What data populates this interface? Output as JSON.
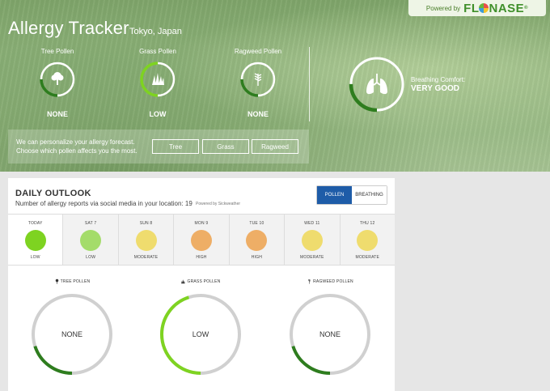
{
  "header": {
    "title": "Allergy Tracker",
    "location": "Tokyo, Japan",
    "sponsor_text": "Powered by",
    "brand_left": "FL",
    "brand_right": "NASE",
    "brand_mark": "®"
  },
  "pollen": [
    {
      "label": "Tree Pollen",
      "level": "NONE",
      "icon": "tree-icon",
      "fill": 0.25
    },
    {
      "label": "Grass Pollen",
      "level": "LOW",
      "icon": "grass-icon",
      "fill": 0.5
    },
    {
      "label": "Ragweed Pollen",
      "level": "NONE",
      "icon": "ragweed-icon",
      "fill": 0.25
    }
  ],
  "breathing": {
    "label": "Breathing Comfort:",
    "value": "VERY GOOD",
    "icon": "lungs-icon",
    "fill": 0.25
  },
  "personalize": {
    "line1": "We can personalize your allergy forecast.",
    "line2": "Choose which pollen affects you the most.",
    "buttons": [
      "Tree",
      "Grass",
      "Ragweed"
    ]
  },
  "outlook": {
    "title": "DAILY OUTLOOK",
    "subtitle": "Number of allergy reports via social media in your location: 19",
    "powered": "Powered by Sickweather",
    "toggle": {
      "pollen": "POLLEN",
      "breathing": "BREATHING"
    },
    "days": [
      {
        "name": "TODAY",
        "level": "LOW",
        "color": "#7ed321"
      },
      {
        "name": "SAT 7",
        "level": "LOW",
        "color": "#a4dc6a"
      },
      {
        "name": "SUN 8",
        "level": "MODERATE",
        "color": "#efdc6e"
      },
      {
        "name": "MON 9",
        "level": "HIGH",
        "color": "#eeae66"
      },
      {
        "name": "TUE 10",
        "level": "HIGH",
        "color": "#eeae66"
      },
      {
        "name": "WED 11",
        "level": "MODERATE",
        "color": "#efdc6e"
      },
      {
        "name": "THU 12",
        "level": "MODERATE",
        "color": "#efdc6e"
      }
    ],
    "details": [
      {
        "label": "TREE POLLEN",
        "value": "NONE",
        "fill": 0.2
      },
      {
        "label": "GRASS POLLEN",
        "value": "LOW",
        "fill": 0.45
      },
      {
        "label": "RAGWEED POLLEN",
        "value": "NONE",
        "fill": 0.2
      }
    ]
  },
  "colors": {
    "accent": "#1e5ca8",
    "ring_dark": "#2e7d1e",
    "ring_light": "#7ed321",
    "ring_track": "#d0d0d0"
  }
}
